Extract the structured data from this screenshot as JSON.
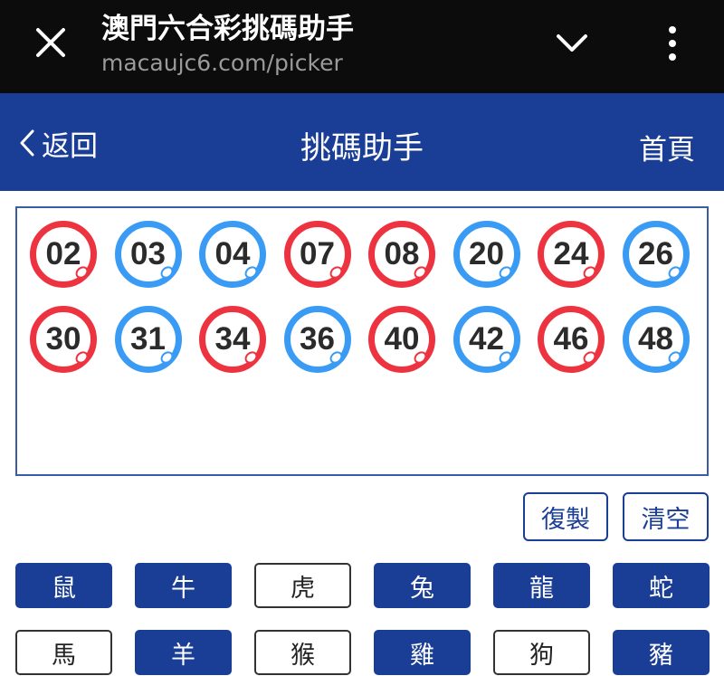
{
  "browser": {
    "title": "澳門六合彩挑碼助手",
    "url": "macaujc6.com/picker"
  },
  "header": {
    "back_label": "返回",
    "title": "挑碼助手",
    "home_label": "首頁"
  },
  "colors": {
    "red_ball": "#ee3340",
    "blue_ball": "#3a9bf5",
    "brand": "#1a3d96"
  },
  "balls": [
    {
      "number": "02",
      "color": "red"
    },
    {
      "number": "03",
      "color": "blue"
    },
    {
      "number": "04",
      "color": "blue"
    },
    {
      "number": "07",
      "color": "red"
    },
    {
      "number": "08",
      "color": "red"
    },
    {
      "number": "20",
      "color": "blue"
    },
    {
      "number": "24",
      "color": "red"
    },
    {
      "number": "26",
      "color": "blue"
    },
    {
      "number": "30",
      "color": "red"
    },
    {
      "number": "31",
      "color": "blue"
    },
    {
      "number": "34",
      "color": "red"
    },
    {
      "number": "36",
      "color": "blue"
    },
    {
      "number": "40",
      "color": "red"
    },
    {
      "number": "42",
      "color": "blue"
    },
    {
      "number": "46",
      "color": "red"
    },
    {
      "number": "48",
      "color": "blue"
    }
  ],
  "actions": {
    "copy_label": "復製",
    "clear_label": "清空"
  },
  "zodiac": [
    {
      "label": "鼠",
      "selected": true
    },
    {
      "label": "牛",
      "selected": true
    },
    {
      "label": "虎",
      "selected": false
    },
    {
      "label": "兔",
      "selected": true
    },
    {
      "label": "龍",
      "selected": true
    },
    {
      "label": "蛇",
      "selected": true
    },
    {
      "label": "馬",
      "selected": false
    },
    {
      "label": "羊",
      "selected": true
    },
    {
      "label": "猴",
      "selected": false
    },
    {
      "label": "雞",
      "selected": true
    },
    {
      "label": "狗",
      "selected": false
    },
    {
      "label": "豬",
      "selected": true
    }
  ]
}
